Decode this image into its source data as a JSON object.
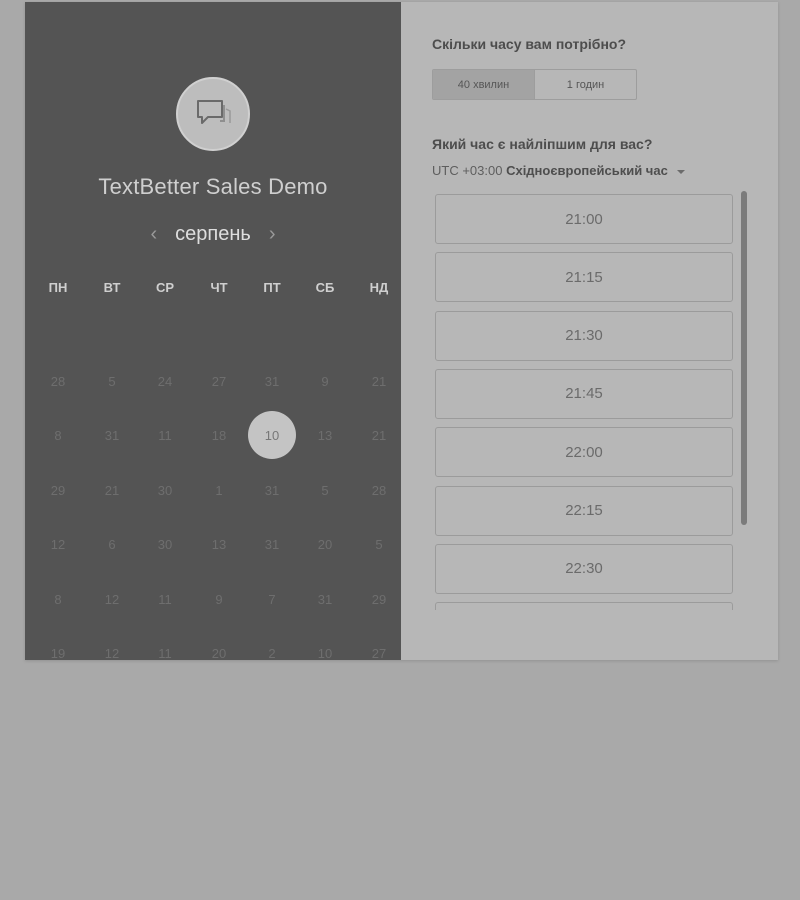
{
  "brand": {
    "name": "TextBetter Sales Demo"
  },
  "calendar": {
    "month": "серпень",
    "weekdays": [
      "ПН",
      "ВТ",
      "СР",
      "ЧТ",
      "ПТ",
      "СБ",
      "НД"
    ],
    "rows": [
      [
        "28",
        "5",
        "24",
        "27",
        "31",
        "9",
        "21"
      ],
      [
        "8",
        "31",
        "11",
        "18",
        "10",
        "13",
        "21"
      ],
      [
        "29",
        "21",
        "30",
        "1",
        "31",
        "5",
        "28"
      ],
      [
        "12",
        "6",
        "30",
        "13",
        "31",
        "20",
        "5"
      ],
      [
        "8",
        "12",
        "11",
        "9",
        "7",
        "31",
        "29"
      ],
      [
        "19",
        "12",
        "11",
        "20",
        "2",
        "10",
        "27"
      ]
    ],
    "selected_day": "10"
  },
  "duration": {
    "question": "Скільки часу вам потрібно?",
    "options": [
      "40 хвилин",
      "1 годин"
    ],
    "selected": "40 хвилин"
  },
  "time": {
    "question": "Який час є найліпшим для вас?",
    "timezone_offset": "UTC +03:00",
    "timezone_name": "Східноєвропейський час",
    "slots": [
      "21:00",
      "21:15",
      "21:30",
      "21:45",
      "22:00",
      "22:15",
      "22:30",
      ""
    ]
  },
  "colors": {
    "left_panel": "#545454",
    "page_background": "#a9a9a9",
    "card_background": "#b7b7b7"
  },
  "icons": {
    "avatar": "chat-bubble-icon",
    "prev": "chevron-left-icon",
    "next": "chevron-right-icon",
    "timezone": "caret-down-icon"
  }
}
